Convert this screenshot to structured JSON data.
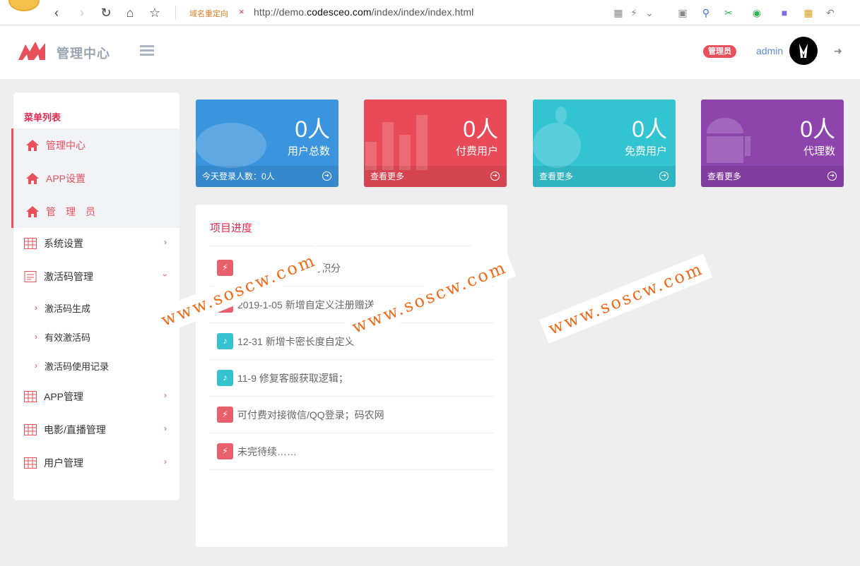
{
  "browser": {
    "redirect_label": "域名重定向",
    "url_prefix": "http://demo.",
    "url_domain": "codesceo.com",
    "url_path": "/index/index/index.html"
  },
  "header": {
    "title": "管理中心",
    "role_badge": "管理员",
    "username": "admin"
  },
  "sidebar": {
    "title": "菜单列表",
    "items": [
      {
        "label": "管理中心"
      },
      {
        "label": "APP设置"
      },
      {
        "label": "管　理　员"
      },
      {
        "label": "系统设置"
      },
      {
        "label": "激活码管理"
      },
      {
        "label": "APP管理"
      },
      {
        "label": "电影/直播管理"
      },
      {
        "label": "用户管理"
      }
    ],
    "subitems": [
      {
        "label": "激活码生成"
      },
      {
        "label": "有效激活码"
      },
      {
        "label": "激活码使用记录"
      }
    ]
  },
  "cards": [
    {
      "value": "0人",
      "label": "用户总数",
      "footer": "今天登录人数：0人",
      "color": "#3b95de"
    },
    {
      "value": "0人",
      "label": "付费用户",
      "footer": "查看更多",
      "color": "#e84a57"
    },
    {
      "value": "0人",
      "label": "免费用户",
      "footer": "查看更多",
      "color": "#33c4d2"
    },
    {
      "value": "0人",
      "label": "代理数",
      "footer": "查看更多",
      "color": "#8e44ad"
    }
  ],
  "progress": {
    "title": "项目进度",
    "items": [
      {
        "text": "邀请奖励积分",
        "icon": "bolt-icon"
      },
      {
        "text": "2019-1-05 新增自定义注册赠送",
        "icon": "bolt-icon"
      },
      {
        "text": "12-31 新增卡密长度自定义",
        "icon": "bell-icon"
      },
      {
        "text": "11-9 修复客服获取逻辑；",
        "icon": "bell-icon"
      },
      {
        "text": "可付费对接微信/QQ登录；码农网",
        "icon": "bolt-icon"
      },
      {
        "text": "未完待续……",
        "icon": "bolt-icon"
      }
    ]
  },
  "watermark": "www.soscw.com"
}
